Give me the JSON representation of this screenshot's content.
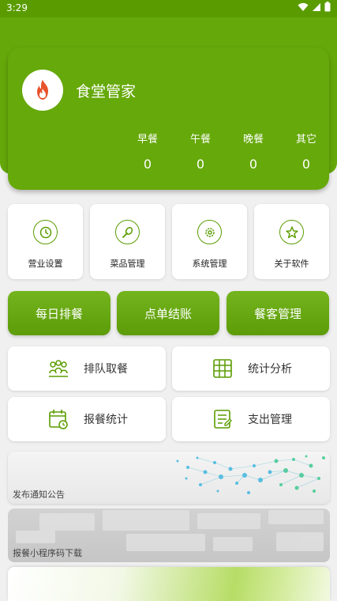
{
  "status_bar": {
    "time": "3:29"
  },
  "header": {
    "app_name": "食堂管家",
    "meals": [
      {
        "label": "早餐",
        "value": "0"
      },
      {
        "label": "午餐",
        "value": "0"
      },
      {
        "label": "晚餐",
        "value": "0"
      },
      {
        "label": "其它",
        "value": "0"
      }
    ]
  },
  "quick_menu": [
    {
      "label": "营业设置",
      "icon": "clock-icon"
    },
    {
      "label": "菜品管理",
      "icon": "food-icon"
    },
    {
      "label": "系统管理",
      "icon": "gear-icon"
    },
    {
      "label": "关于软件",
      "icon": "star-icon"
    }
  ],
  "main_actions": [
    {
      "label": "每日排餐"
    },
    {
      "label": "点单结账"
    },
    {
      "label": "餐客管理"
    }
  ],
  "features": [
    {
      "label": "排队取餐",
      "icon": "queue-people-icon"
    },
    {
      "label": "统计分析",
      "icon": "table-grid-icon"
    },
    {
      "label": "报餐统计",
      "icon": "calendar-clock-icon"
    },
    {
      "label": "支出管理",
      "icon": "document-icon"
    }
  ],
  "banners": [
    {
      "label": "发布通知公告"
    },
    {
      "label": "报餐小程序码下载"
    }
  ],
  "colors": {
    "primary": "#65a80a",
    "primary_dark": "#5a9c00",
    "background": "#f0f0f0",
    "logo_flame": "#e8512b"
  }
}
